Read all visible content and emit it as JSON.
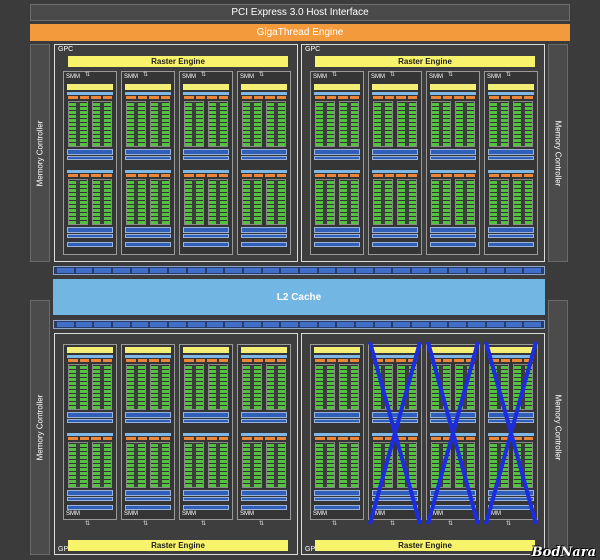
{
  "host_interface": "PCI Express 3.0 Host Interface",
  "thread_engine": "GigaThread Engine",
  "memory_controller_label": "Memory Controller",
  "l2_cache": "L2 Cache",
  "gpc_label": "GPC",
  "raster_label": "Raster Engine",
  "smm_label": "SMM",
  "disabled_smm_note_color": "#1c2de0",
  "watermark": "BodNara",
  "colors": {
    "background": "#3b3b3b",
    "giga_engine": "#f39a3c",
    "l2_cache": "#72b6e4",
    "raster_engine": "#f7f36b",
    "cuda_cores": "#56c043",
    "ld_st": "#2f5fb8",
    "sfu": "#e9863a"
  }
}
